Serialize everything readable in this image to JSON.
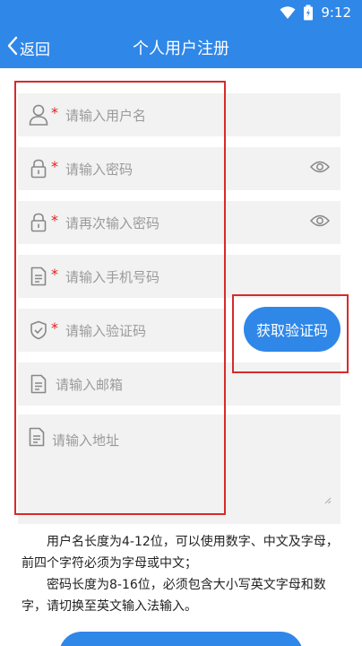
{
  "status": {
    "time": "9:12"
  },
  "header": {
    "back_label": "返回",
    "title": "个人用户注册"
  },
  "fields": {
    "username": {
      "placeholder": "请输入用户名",
      "required": "*"
    },
    "password": {
      "placeholder": "请输入密码",
      "required": "*"
    },
    "password_confirm": {
      "placeholder": "请再次输入密码",
      "required": "*"
    },
    "phone": {
      "placeholder": "请输入手机号码",
      "required": "*"
    },
    "code": {
      "placeholder": "请输入验证码",
      "required": "*"
    },
    "email": {
      "placeholder": "请输入邮箱"
    },
    "address": {
      "placeholder": "请输入地址"
    }
  },
  "sms_button": {
    "label": "获取验证码"
  },
  "hints": [
    "用户名长度为4-12位，可以使用数字、中文及字母，前四个字符必须为字母或中文；",
    "密码长度为8-16位，必须包含大小写英文字母和数字，请切换至英文输入法输入。"
  ],
  "colors": {
    "primary": "#2f87e8",
    "field_bg": "#f1f2f1",
    "required": "#e02020",
    "highlight": "#d62b2b"
  }
}
